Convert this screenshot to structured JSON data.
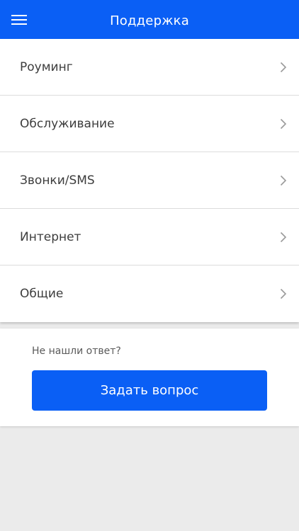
{
  "header": {
    "title": "Поддержка",
    "menu_icon": "hamburger-menu-icon",
    "color": "#0a5ff5"
  },
  "categories": [
    {
      "label": "Роуминг",
      "icon": "chevron-right-icon"
    },
    {
      "label": "Обслуживание",
      "icon": "chevron-right-icon"
    },
    {
      "label": "Звонки/SMS",
      "icon": "chevron-right-icon"
    },
    {
      "label": "Интернет",
      "icon": "chevron-right-icon"
    },
    {
      "label": "Общие",
      "icon": "chevron-right-icon"
    }
  ],
  "help": {
    "caption": "Не нашли ответ?",
    "button_label": "Задать вопрос"
  },
  "colors": {
    "accent": "#0a5ff5",
    "background": "#ebebeb",
    "text": "#3d3d3d"
  }
}
